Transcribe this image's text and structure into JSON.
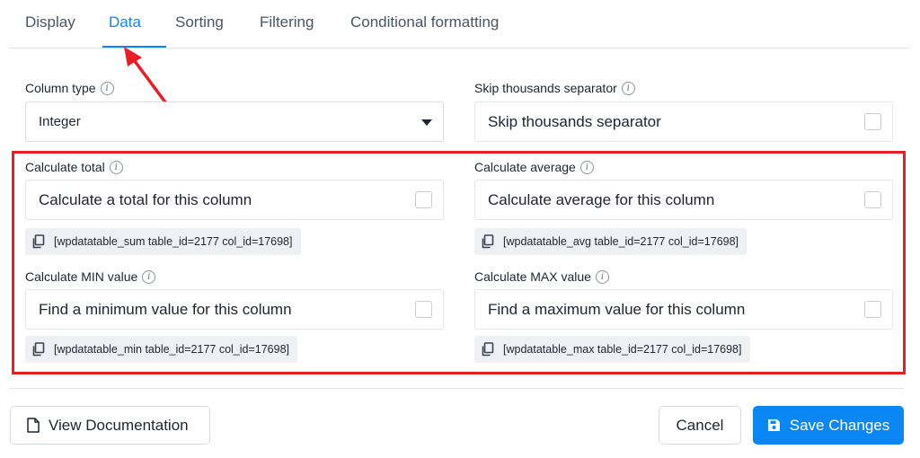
{
  "tabs": [
    {
      "label": "Display",
      "active": false
    },
    {
      "label": "Data",
      "active": true
    },
    {
      "label": "Sorting",
      "active": false
    },
    {
      "label": "Filtering",
      "active": false
    },
    {
      "label": "Conditional formatting",
      "active": false
    }
  ],
  "column_type": {
    "label": "Column type",
    "value": "Integer"
  },
  "skip_thousands": {
    "label": "Skip thousands separator",
    "checkbox_label": "Skip thousands separator",
    "checked": false
  },
  "calc_total": {
    "label": "Calculate total",
    "checkbox_label": "Calculate a total for this column",
    "checked": false,
    "shortcode": "[wpdatatable_sum table_id=2177 col_id=17698]"
  },
  "calc_average": {
    "label": "Calculate average",
    "checkbox_label": "Calculate average for this column",
    "checked": false,
    "shortcode": "[wpdatatable_avg table_id=2177 col_id=17698]"
  },
  "calc_min": {
    "label": "Calculate MIN value",
    "checkbox_label": "Find a minimum value for this column",
    "checked": false,
    "shortcode": "[wpdatatable_min table_id=2177 col_id=17698]"
  },
  "calc_max": {
    "label": "Calculate MAX value",
    "checkbox_label": "Find a maximum value for this column",
    "checked": false,
    "shortcode": "[wpdatatable_max table_id=2177 col_id=17698]"
  },
  "footer": {
    "doc_label": "View Documentation",
    "cancel_label": "Cancel",
    "save_label": "Save Changes"
  },
  "icons": {
    "info": "info-icon",
    "copy": "copy-icon",
    "document": "document-icon",
    "save": "floppy-disk-icon",
    "caret": "caret-down-icon"
  },
  "colors": {
    "accent": "#0a86f5",
    "highlight": "#ec1c24",
    "annotation_arrow": "#ec1c24"
  }
}
